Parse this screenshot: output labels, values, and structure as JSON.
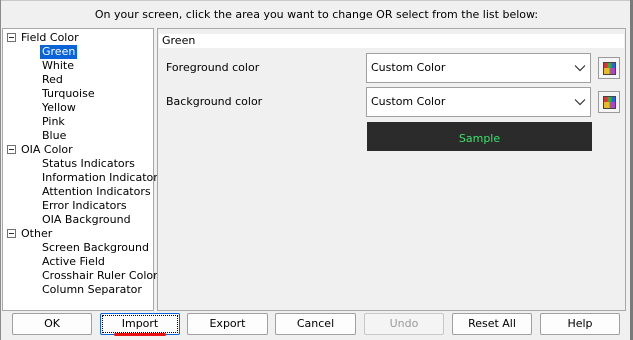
{
  "instruction": "On your screen, click the area you want to change OR select from the list below:",
  "tree": {
    "groups": [
      {
        "label": "Field Color",
        "items": [
          "Green",
          "White",
          "Red",
          "Turquoise",
          "Yellow",
          "Pink",
          "Blue"
        ]
      },
      {
        "label": "OIA Color",
        "items": [
          "Status Indicators",
          "Information Indicators",
          "Attention Indicators",
          "Error Indicators",
          "OIA Background"
        ]
      },
      {
        "label": "Other",
        "items": [
          "Screen Background",
          "Active Field",
          "Crosshair Ruler Color",
          "Column Separator"
        ]
      }
    ],
    "selected": "Green"
  },
  "panel": {
    "title": "Green",
    "foreground_label": "Foreground color",
    "foreground_value": "Custom Color",
    "background_label": "Background color",
    "background_value": "Custom Color",
    "sample_text": "Sample"
  },
  "buttons": {
    "ok": "OK",
    "import": "Import",
    "export": "Export",
    "cancel": "Cancel",
    "undo": "Undo",
    "reset_all": "Reset All",
    "help": "Help"
  },
  "colors": {
    "selection": "#0a64d8",
    "sample_background": "#2b2b2b",
    "sample_text": "#3ee06a",
    "annotation_underline": "#e81010"
  },
  "icons": {
    "tree_toggle": "collapse-minus-icon",
    "dropdown": "chevron-down-icon",
    "color_picker": "color-palette-icon"
  }
}
